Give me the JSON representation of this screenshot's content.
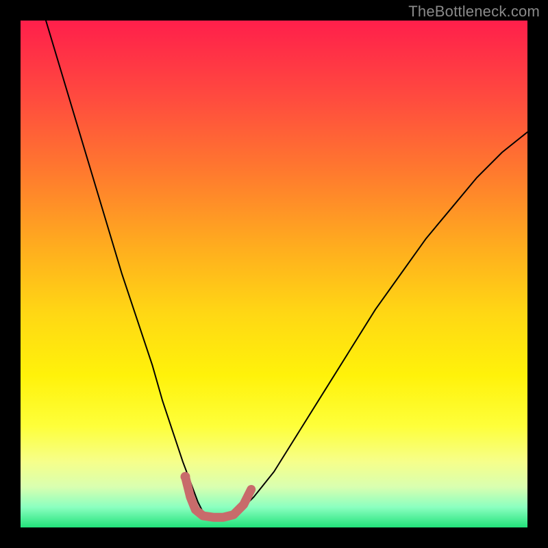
{
  "watermark": "TheBottleneck.com",
  "colors": {
    "black": "#000000",
    "gradient_stops": [
      {
        "pos": 0.0,
        "color": "#ff1f4b"
      },
      {
        "pos": 0.15,
        "color": "#ff4a3f"
      },
      {
        "pos": 0.3,
        "color": "#ff7a2e"
      },
      {
        "pos": 0.45,
        "color": "#ffae1e"
      },
      {
        "pos": 0.58,
        "color": "#ffd814"
      },
      {
        "pos": 0.7,
        "color": "#fff20a"
      },
      {
        "pos": 0.8,
        "color": "#feff3a"
      },
      {
        "pos": 0.87,
        "color": "#f6ff8a"
      },
      {
        "pos": 0.92,
        "color": "#d9ffb0"
      },
      {
        "pos": 0.96,
        "color": "#8bffc0"
      },
      {
        "pos": 1.0,
        "color": "#22e27a"
      }
    ],
    "curve": "#000000",
    "highlight": "#c86b6b"
  },
  "chart_data": {
    "type": "line",
    "title": "",
    "xlabel": "",
    "ylabel": "",
    "xlim": [
      0,
      100
    ],
    "ylim": [
      0,
      100
    ],
    "series": [
      {
        "name": "bottleneck-curve",
        "x": [
          5,
          8,
          11,
          14,
          17,
          20,
          23,
          26,
          28,
          30,
          32,
          33.5,
          35,
          36,
          37.5,
          40,
          43,
          46,
          50,
          55,
          60,
          65,
          70,
          75,
          80,
          85,
          90,
          95,
          100
        ],
        "y": [
          100,
          90,
          80,
          70,
          60,
          50,
          41,
          32,
          25,
          19,
          13,
          9,
          5,
          3,
          2,
          2,
          3,
          6,
          11,
          19,
          27,
          35,
          43,
          50,
          57,
          63,
          69,
          74,
          78
        ]
      },
      {
        "name": "optimal-highlight",
        "x": [
          32.5,
          33.5,
          34.5,
          36,
          38,
          40,
          42,
          44,
          45.5
        ],
        "y": [
          10,
          6,
          3.5,
          2.3,
          2.0,
          2.0,
          2.5,
          4.5,
          7.5
        ]
      }
    ],
    "markers": [
      {
        "name": "highlight-dot",
        "x": 32.5,
        "y": 10
      }
    ]
  }
}
